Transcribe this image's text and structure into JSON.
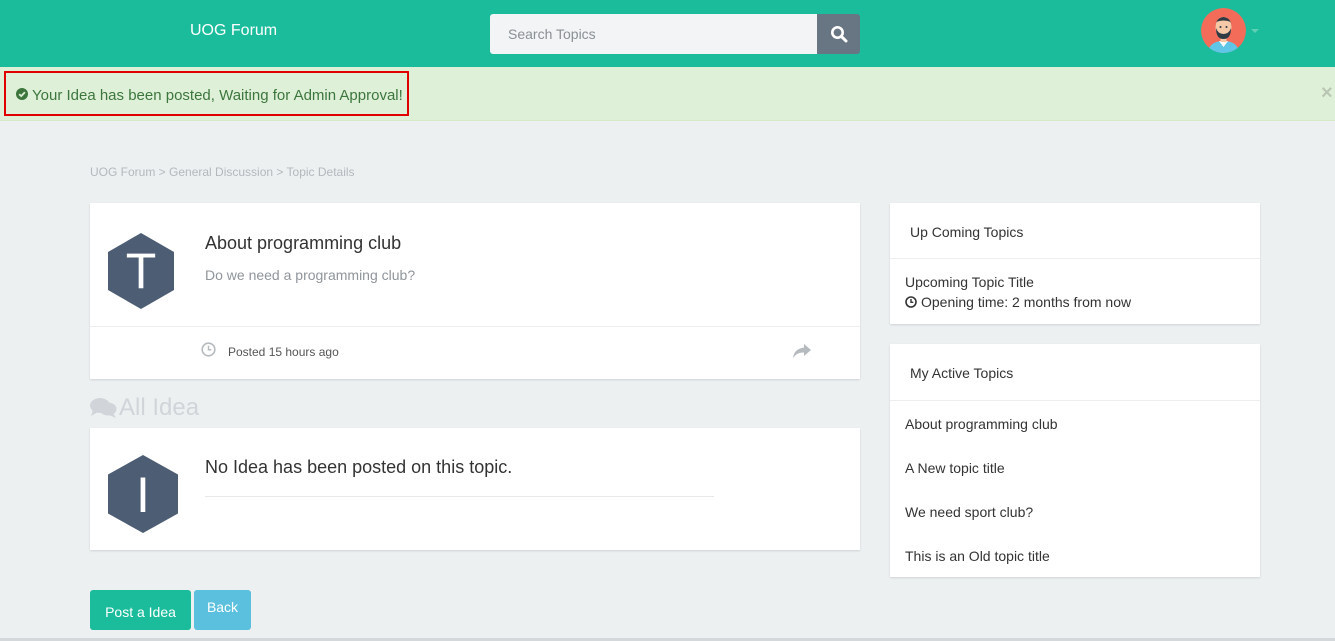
{
  "header": {
    "brand": "UOG Forum",
    "search_placeholder": "Search Topics"
  },
  "alert": {
    "message": "Your Idea has been posted, Waiting for Admin Approval!",
    "close": "×"
  },
  "breadcrumb": "UOG Forum > General Discussion > Topic Details",
  "topic": {
    "avatar_letter": "T",
    "title": "About programming club",
    "description": "Do we need a programming club?",
    "posted": "Posted 15 hours ago"
  },
  "ideas_section": {
    "heading": "All Idea",
    "avatar_letter": "I",
    "empty_message": "No Idea has been posted on this topic."
  },
  "buttons": {
    "post": "Post a Idea",
    "back": "Back"
  },
  "sidebar": {
    "upcoming": {
      "heading": "Up Coming Topics",
      "title": "Upcoming Topic Title",
      "opening": "Opening time: 2 months from now"
    },
    "active": {
      "heading": "My Active Topics",
      "items": [
        "About programming club",
        "A New topic title",
        "We need sport club?",
        "This is an Old topic title"
      ]
    }
  },
  "colors": {
    "primary": "#1abc9c",
    "search_button": "#687582",
    "alert_bg": "#dff0d8",
    "alert_text": "#3c763d",
    "hex_avatar": "#4d5d73",
    "info_button": "#5bc0de"
  }
}
